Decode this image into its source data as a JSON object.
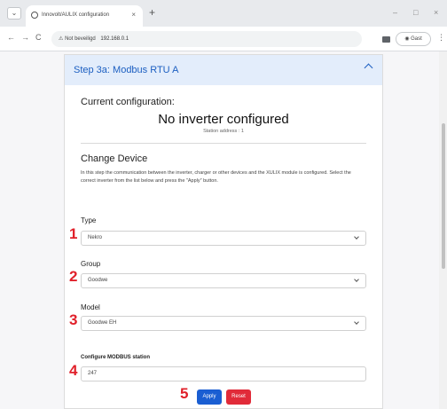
{
  "browser": {
    "tab_title": "Innovolt/AULIX configuration",
    "tab_close": "×",
    "new_tab": "+",
    "window_min": "–",
    "window_max": "□",
    "window_close": "×",
    "nav_back": "←",
    "nav_forward": "→",
    "nav_reload": "C",
    "security_label": "Not beveiligd",
    "url": "192.168.0.1",
    "profile_label": "Gast",
    "menu_label": "⋮"
  },
  "card": {
    "title": "Step 3a: Modbus RTU A",
    "current_config_title": "Current configuration:",
    "status_text": "No inverter configured",
    "station_address": "Station address : 1",
    "change_title": "Change Device",
    "description": "In this step the communication between the inverter, charger or other devices and the XULIX module is configured. Select the correct inverter from the list below and press the \"Apply\" button.",
    "fields": {
      "type_label": "Type",
      "type_value": "Nekro",
      "group_label": "Group",
      "group_value": "Goodwe",
      "model_label": "Model",
      "model_value": "Goodwe EH",
      "station_label": "Configure MODBUS station",
      "station_value": "247"
    },
    "apply_label": "Apply",
    "reset_label": "Reset"
  },
  "annotations": {
    "n1": "1",
    "n2": "2",
    "n3": "3",
    "n4": "4",
    "n5": "5"
  },
  "colors": {
    "accent": "#1c5fc1",
    "header_bg": "#e3edfb",
    "annotation": "#e0202a",
    "apply": "#1a5ed2",
    "reset": "#e12b39"
  }
}
